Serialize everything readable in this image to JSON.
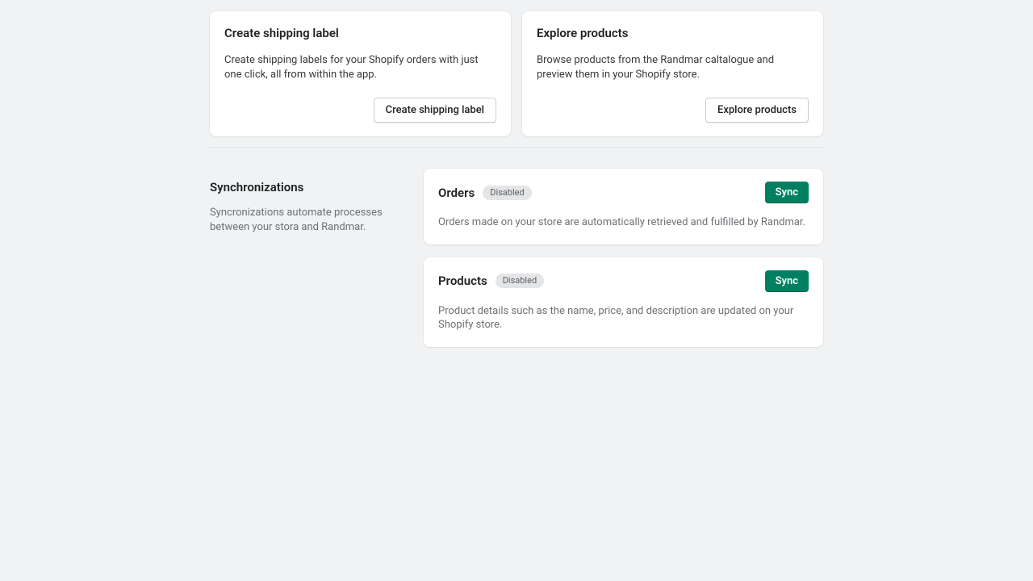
{
  "top_cards": [
    {
      "title": "Create shipping label",
      "desc": "Create shipping labels for your Shopify orders with just one click, all from within the app.",
      "button": "Create shipping label"
    },
    {
      "title": "Explore products",
      "desc": "Browse products from the Randmar caltalogue and preview them in your Shopify store.",
      "button": "Explore products"
    }
  ],
  "section": {
    "title": "Synchronizations",
    "desc": "Syncronizations automate processes between your stora and Randmar."
  },
  "sync_cards": [
    {
      "title": "Orders",
      "badge": "Disabled",
      "button": "Sync",
      "desc": "Orders made on your store are automatically retrieved and fulfilled by Randmar."
    },
    {
      "title": "Products",
      "badge": "Disabled",
      "button": "Sync",
      "desc": "Product details such as the name, price, and description are updated on your Shopify store."
    }
  ]
}
